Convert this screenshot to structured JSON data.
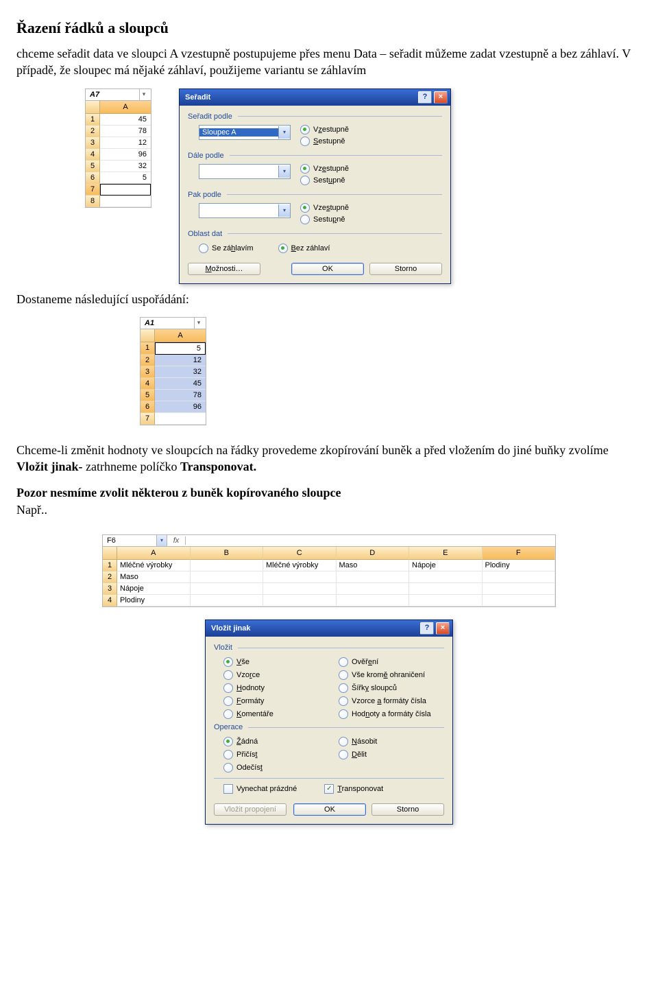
{
  "title": "Řazení řádků a sloupců",
  "p1": "chceme seřadit data ve sloupci A vzestupně postupujeme přes menu Data – seřadit můžeme zadat vzestupně a bez záhlaví. V případě, že sloupec má nějaké záhlaví, použijeme variantu se záhlavím",
  "p2": "Dostaneme následující uspořádání:",
  "p3_a": "Chceme-li změnit hodnoty ve sloupcích na řádky provedeme zkopírování buněk a před vložením do jiné buňky zvolíme ",
  "p3_b": "Vložit jinak-",
  "p3_c": " zatrhneme políčko ",
  "p3_d": "Transponovat.",
  "p4": "Pozor nesmíme zvolit některou z buněk kopírovaného sloupce",
  "p5": "Např..",
  "snip1": {
    "nb": "A7",
    "col": "A",
    "vals": [
      "45",
      "78",
      "12",
      "96",
      "32",
      "5",
      "",
      ""
    ],
    "rows": [
      "1",
      "2",
      "3",
      "4",
      "5",
      "6",
      "7",
      "8"
    ]
  },
  "snip2": {
    "nb": "A1",
    "col": "A",
    "vals": [
      "5",
      "12",
      "32",
      "45",
      "78",
      "96",
      ""
    ],
    "rows": [
      "1",
      "2",
      "3",
      "4",
      "5",
      "6",
      "7"
    ]
  },
  "sortdlg": {
    "title": "Seřadit",
    "g1": "Seřadit podle",
    "g2": "Dále podle",
    "g3": "Pak podle",
    "g4": "Oblast dat",
    "combo1": "Sloupec A",
    "combo2": "",
    "combo3": "",
    "asc": "Vzestupně",
    "desc": "Sestupně",
    "hdr_yes": "Se záhlavím",
    "hdr_no": "Bez záhlaví",
    "opt_u": "M",
    "opt_rest": "ožnosti…",
    "ok": "OK",
    "cancel": "Storno"
  },
  "wide": {
    "nb": "F6",
    "cols": [
      "A",
      "B",
      "C",
      "D",
      "E",
      "F"
    ],
    "rows": [
      [
        "Mléčné výrobky",
        "",
        "Mléčné výrobky",
        "Maso",
        "Nápoje",
        "Plodiny"
      ],
      [
        "Maso",
        "",
        "",
        "",
        "",
        ""
      ],
      [
        "Nápoje",
        "",
        "",
        "",
        "",
        ""
      ],
      [
        "Plodiny",
        "",
        "",
        "",
        "",
        ""
      ]
    ],
    "rhs": [
      "1",
      "2",
      "3",
      "4"
    ]
  },
  "ps": {
    "title": "Vložit jinak",
    "g1": "Vložit",
    "g2": "Operace",
    "left1": [
      [
        "V",
        "še",
        true
      ],
      [
        "Vzo",
        "rce",
        false
      ],
      [
        "H",
        "odnoty",
        false
      ],
      [
        "F",
        "ormáty",
        false
      ],
      [
        "K",
        "omentáře",
        false
      ]
    ],
    "right1": [
      [
        "Ověř",
        "ení",
        false
      ],
      [
        "Vše krom",
        "ě ohraničení",
        false
      ],
      [
        "Šířk",
        "y sloupců",
        false
      ],
      [
        "Vzorce ",
        "a formáty čísla",
        false
      ],
      [
        "Hod",
        "noty a formáty čísla",
        false
      ]
    ],
    "left2": [
      [
        "Ž",
        "ádná",
        true
      ],
      [
        "Přičís",
        "t",
        false
      ],
      [
        "Odečís",
        "t",
        false
      ]
    ],
    "right2": [
      [
        "N",
        "ásobit",
        false
      ],
      [
        "D",
        "ělit",
        false
      ]
    ],
    "skip": "Vynechat prázdné",
    "trans_u": "T",
    "trans_rest": "ransponovat",
    "link": "Vložit propojení",
    "ok": "OK",
    "cancel": "Storno"
  }
}
